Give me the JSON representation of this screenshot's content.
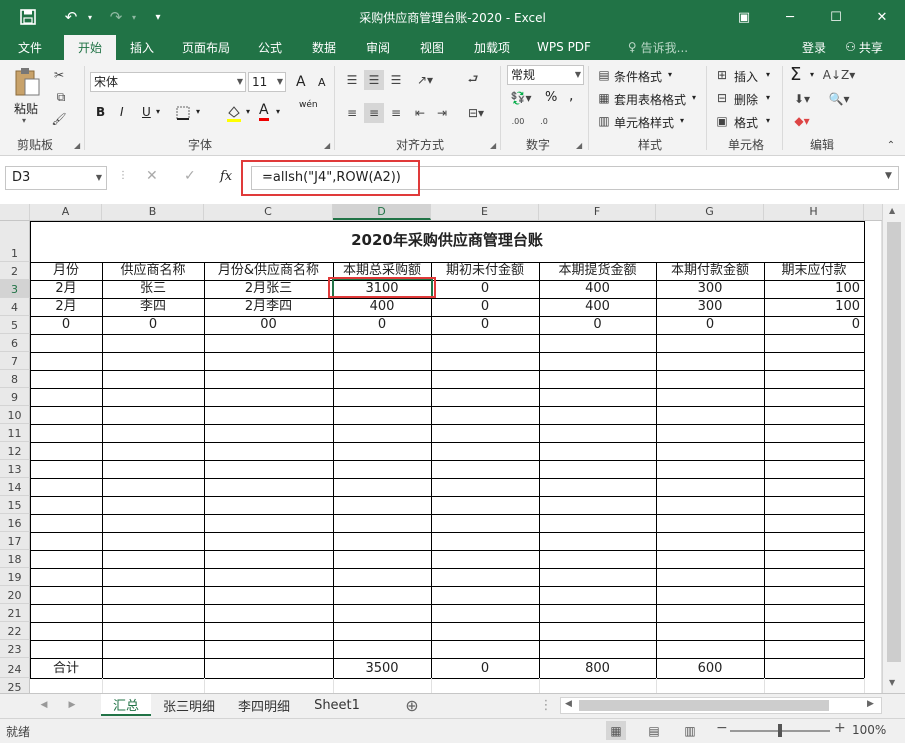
{
  "window": {
    "title": "采购供应商管理台账-2020 - Excel",
    "qat": {
      "save_icon": "save-icon",
      "undo_icon": "undo-icon",
      "redo_icon": "redo-icon"
    },
    "buttons": {
      "restore_ribbon": "▣",
      "minimize": "─",
      "maximize": "☐",
      "close": "✕"
    }
  },
  "tabs": [
    "文件",
    "开始",
    "插入",
    "页面布局",
    "公式",
    "数据",
    "审阅",
    "视图",
    "加载项",
    "WPS PDF"
  ],
  "tell_me": "告诉我...",
  "login": "登录",
  "share": "共享",
  "ribbon": {
    "clipboard": {
      "label": "剪贴板",
      "paste": "粘贴"
    },
    "font": {
      "label": "字体",
      "name": "宋体",
      "size": "11",
      "bold": "B",
      "italic": "I",
      "underline": "U",
      "grow": "A",
      "shrink": "A",
      "wen": "wén",
      "font_color": "A"
    },
    "alignment": {
      "label": "对齐方式"
    },
    "number": {
      "label": "数字",
      "format": "常规",
      "percent": "%",
      "comma": ","
    },
    "styles": {
      "label": "样式",
      "conditional": "条件格式",
      "table": "套用表格格式",
      "cell_styles": "单元格样式"
    },
    "cells": {
      "label": "单元格",
      "insert": "插入",
      "delete": "删除",
      "format": "格式"
    },
    "editing": {
      "label": "编辑",
      "sum": "Σ"
    }
  },
  "formula_bar": {
    "name_box": "D3",
    "formula": "=allsh(\"J4\",ROW(A2))",
    "fx": "fx"
  },
  "columns": [
    "A",
    "B",
    "C",
    "D",
    "E",
    "F",
    "G",
    "H"
  ],
  "rows": [
    "1",
    "2",
    "3",
    "4",
    "5",
    "6",
    "7",
    "8",
    "9",
    "10",
    "11",
    "12",
    "13",
    "14",
    "15",
    "16",
    "17",
    "18",
    "19",
    "20",
    "21",
    "22",
    "23",
    "24",
    "25"
  ],
  "sheet": {
    "title": "2020年采购供应商管理台账",
    "headers": [
      "月份",
      "供应商名称",
      "月份&供应商名称",
      "本期总采购额",
      "期初未付金额",
      "本期提货金额",
      "本期付款金额",
      "期末应付款"
    ],
    "data_rows": [
      [
        "2月",
        "张三",
        "2月张三",
        "3100",
        "0",
        "400",
        "300",
        "100"
      ],
      [
        "2月",
        "李四",
        "2月李四",
        "400",
        "0",
        "400",
        "300",
        "100"
      ],
      [
        "0",
        "0",
        "00",
        "0",
        "0",
        "0",
        "0",
        "0"
      ]
    ],
    "total_row": [
      "合计",
      "",
      "",
      "3500",
      "0",
      "800",
      "600",
      ""
    ]
  },
  "sheet_tabs": [
    "汇总",
    "张三明细",
    "李四明细",
    "Sheet1"
  ],
  "status": {
    "ready": "就绪",
    "zoom": "100%"
  }
}
